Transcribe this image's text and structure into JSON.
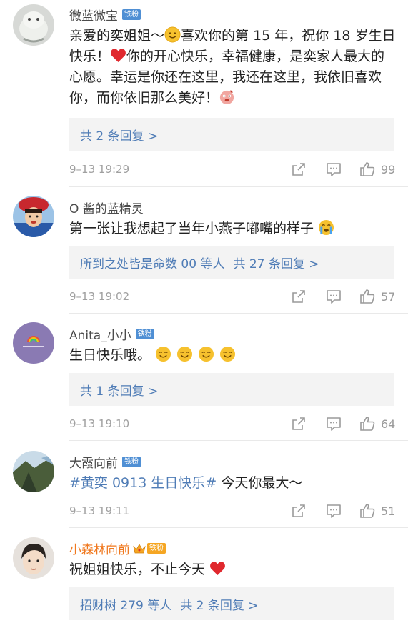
{
  "comments": [
    {
      "user": "微蓝微宝",
      "badge": "铁粉",
      "parts": [
        "亲爱的奕姐姐～",
        "喜欢你的第 15 年，祝你 18 岁生日快乐！",
        "你的开心快乐，幸福健康，是奕家人最大的心愿。幸运是你还在这里，我还在这里，我依旧喜欢你，而你依旧那么美好！"
      ],
      "reply_summary": "共 2 条回复 >",
      "time": "9–13 19:29",
      "likes": "99"
    },
    {
      "user": "O 酱的蓝精灵",
      "text": "第一张让我想起了当年小燕子嘟嘴的样子",
      "reply_users": "所到之处皆是命数 00 等人",
      "reply_summary": "共 27 条回复 >",
      "time": "9–13 19:02",
      "likes": "57"
    },
    {
      "user": "Anita_小小",
      "badge": "铁粉",
      "text": "生日快乐哦。",
      "reply_summary": "共 1 条回复 >",
      "time": "9–13 19:10",
      "likes": "64"
    },
    {
      "user": "大霞向前",
      "badge": "铁粉",
      "hashtag": "#黄奕 0913 生日快乐#",
      "text": " 今天你最大～",
      "time": "9–13 19:11",
      "likes": "51"
    },
    {
      "user": "小森林向前",
      "badge": "铁粉",
      "text": "祝姐姐快乐，不止今天",
      "reply_users": "招财树 279 等人",
      "reply_summary": "共 2 条回复 >"
    }
  ],
  "colors": {
    "link": "#4f7cb6",
    "badge": "#4f8fd4",
    "vip_name": "#f0781e",
    "heart": "#e0282e"
  },
  "icons": [
    "share-icon",
    "comment-icon",
    "like-icon",
    "heart-icon",
    "smile-emoji-icon",
    "crying-emoji-icon",
    "crown-icon"
  ]
}
